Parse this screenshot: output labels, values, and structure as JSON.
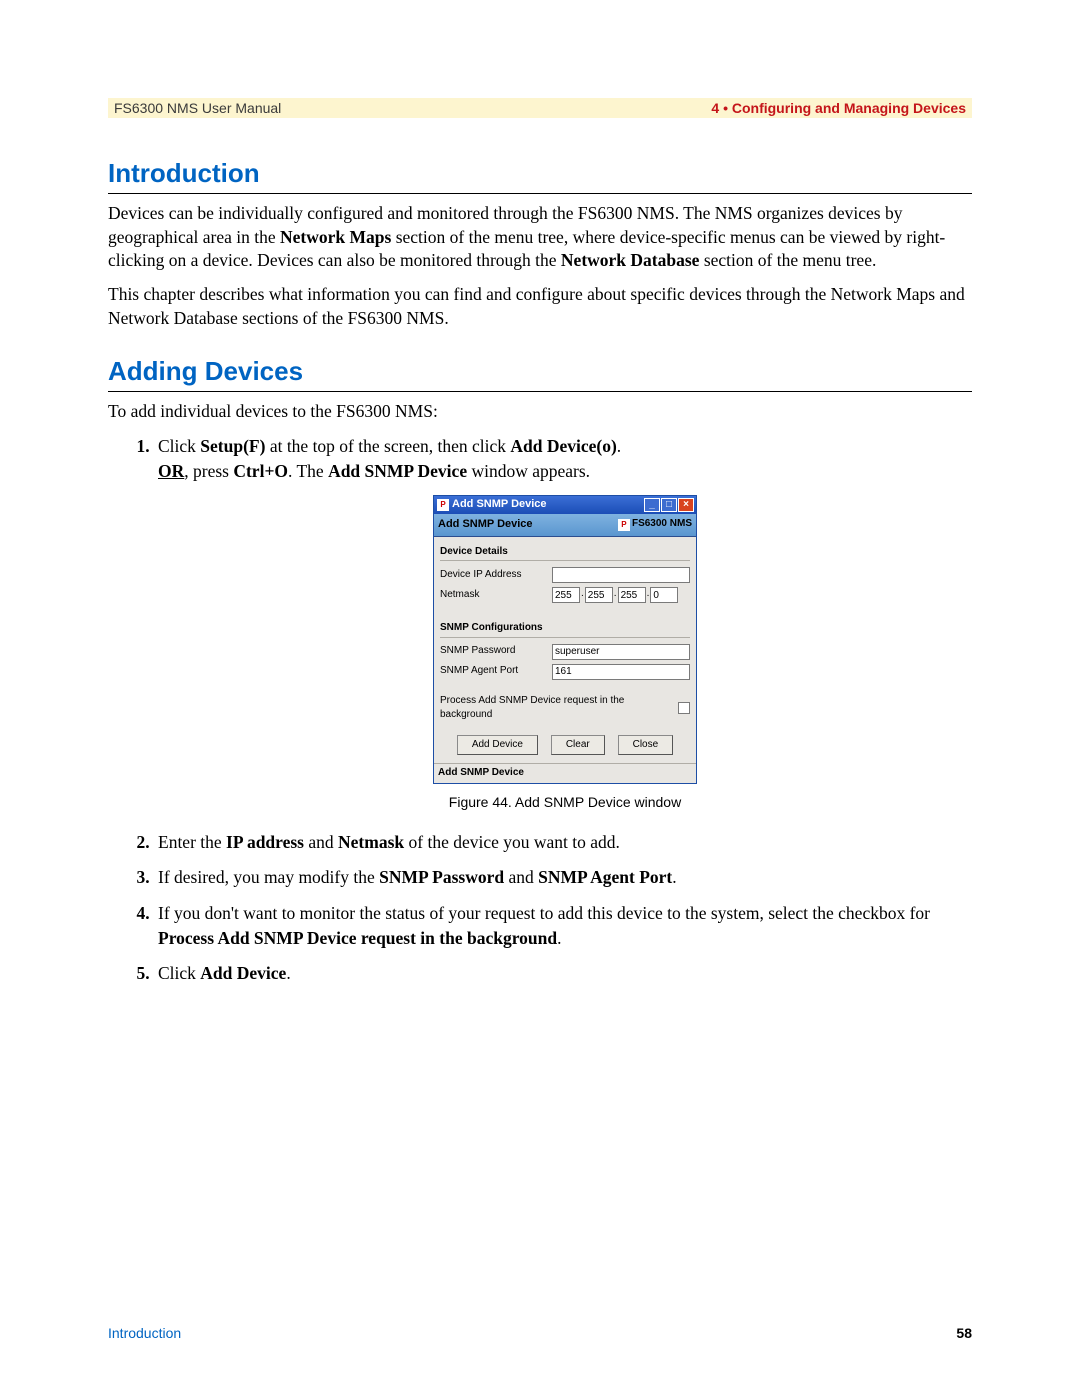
{
  "header": {
    "left": "FS6300 NMS User Manual",
    "right": "4 • Configuring and Managing Devices"
  },
  "section1": {
    "title": "Introduction",
    "para1_parts": {
      "t1": "Devices can be individually configured and monitored through the FS6300 NMS. The NMS organizes devices by geographical area in the ",
      "b1": "Network Maps",
      "t2": " section of the menu tree, where device-specific menus can be viewed by right-clicking on a device. Devices can also be monitored through the ",
      "b2": "Network Database",
      "t3": " section of the menu tree."
    },
    "para2": "This chapter describes what information you can find and configure about specific devices through the Network Maps and Network Database sections of the FS6300 NMS."
  },
  "section2": {
    "title": "Adding Devices",
    "intro": "To add individual devices to the FS6300 NMS:",
    "step1": {
      "t1": "Click ",
      "b1": "Setup(F)",
      "t2": " at the top of the screen, then click ",
      "b2": "Add Device(o)",
      "t3": ".",
      "l2a": "OR",
      "l2t": ", press ",
      "l2b1": "Ctrl+O",
      "l2t2": ". The ",
      "l2b2": "Add SNMP Device",
      "l2t3": " window appears."
    },
    "step2": {
      "t1": "Enter the ",
      "b1": "IP address",
      "t2": " and ",
      "b2": "Netmask",
      "t3": " of the device you want to add."
    },
    "step3": {
      "t1": "If desired, you may modify the ",
      "b1": "SNMP Password",
      "t2": " and ",
      "b2": "SNMP Agent Port",
      "t3": "."
    },
    "step4": {
      "t1": "If you don't want to monitor the status of your request to add this device to the system, select the checkbox for ",
      "b1": "Process Add SNMP Device request in the background",
      "t2": "."
    },
    "step5": {
      "t1": "Click ",
      "b1": "Add Device",
      "t2": "."
    }
  },
  "dialog": {
    "title": "Add SNMP Device",
    "subhead": "Add SNMP Device",
    "brand": "FS6300 NMS",
    "group1": "Device Details",
    "ip_label": "Device IP Address",
    "netmask_label": "Netmask",
    "netmask": {
      "o1": "255",
      "o2": "255",
      "o3": "255",
      "o4": "0"
    },
    "group2": "SNMP Configurations",
    "snmp_pass_label": "SNMP Password",
    "snmp_pass_value": "superuser",
    "snmp_port_label": "SNMP Agent Port",
    "snmp_port_value": "161",
    "bg_label": "Process Add SNMP Device request in the background",
    "btn_add": "Add Device",
    "btn_clear": "Clear",
    "btn_close": "Close",
    "status": "Add SNMP Device"
  },
  "figure_caption": "Figure 44. Add SNMP Device window",
  "footer": {
    "left": "Introduction",
    "right": "58"
  }
}
